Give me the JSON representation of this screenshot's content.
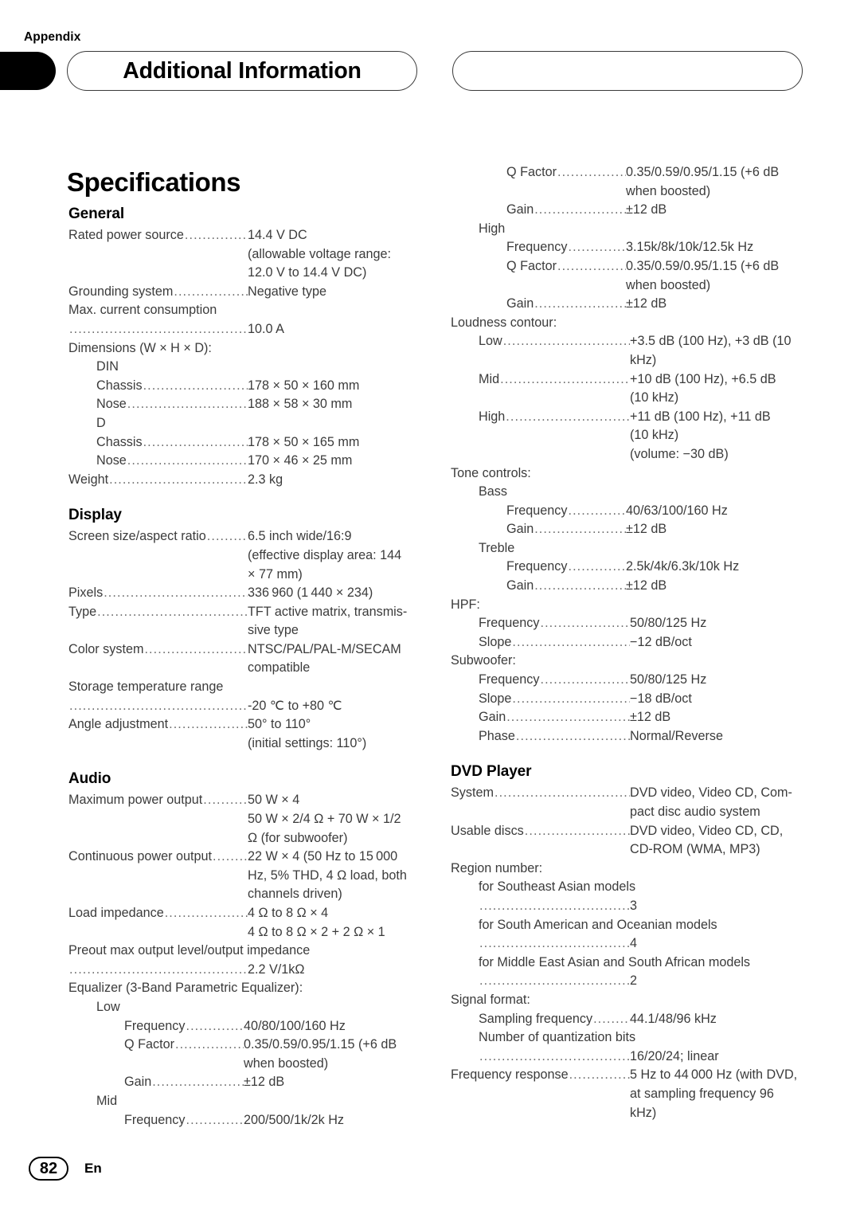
{
  "header": {
    "appendix_label": "Appendix",
    "title": "Additional Information"
  },
  "page_heading": "Specifications",
  "footer": {
    "page_number": "82",
    "language_code": "En"
  },
  "leader_dots": "....................................................................................................",
  "sections": {
    "general": {
      "title": "General",
      "rows": [
        {
          "label": "Rated power source",
          "value": "14.4 V DC"
        },
        {
          "label": "",
          "value": "(allowable voltage range:"
        },
        {
          "label": "",
          "value": "12.0 V to 14.4 V DC)"
        },
        {
          "label": "Grounding system",
          "value": "Negative type"
        },
        {
          "label": "Max. current consumption",
          "value": ""
        },
        {
          "label": "",
          "value": "10.0 A"
        },
        {
          "label": "Dimensions (W × H × D):",
          "value": ""
        },
        {
          "label": "DIN",
          "value": ""
        },
        {
          "label": "Chassis",
          "value": "178 × 50 × 160 mm"
        },
        {
          "label": "Nose",
          "value": "188 × 58 × 30 mm"
        },
        {
          "label": "D",
          "value": ""
        },
        {
          "label": "Chassis",
          "value": "178 × 50 × 165 mm"
        },
        {
          "label": "Nose",
          "value": "170 × 46 × 25 mm"
        },
        {
          "label": "Weight",
          "value": "2.3 kg"
        }
      ]
    },
    "display": {
      "title": "Display",
      "rows": [
        {
          "label": "Screen size/aspect ratio",
          "value": "6.5 inch wide/16:9"
        },
        {
          "label": "",
          "value": "(effective display area: 144"
        },
        {
          "label": "",
          "value": "× 77 mm)"
        },
        {
          "label": "Pixels",
          "value": "336 960 (1 440 × 234)"
        },
        {
          "label": "Type",
          "value": "TFT active matrix, transmis-"
        },
        {
          "label": "",
          "value": "sive type"
        },
        {
          "label": "Color system",
          "value": "NTSC/PAL/PAL-M/SECAM"
        },
        {
          "label": "",
          "value": "compatible"
        },
        {
          "label": "Storage temperature range",
          "value": ""
        },
        {
          "label": "",
          "value": "-20 ℃ to +80 ℃"
        },
        {
          "label": "Angle adjustment",
          "value": "50° to 110°"
        },
        {
          "label": "",
          "value": "(initial settings: 110°)"
        }
      ]
    },
    "audio": {
      "title": "Audio",
      "rows": [
        {
          "label": "Maximum power output",
          "value": "50 W × 4"
        },
        {
          "label": "",
          "value": "50 W × 2/4 Ω + 70 W × 1/2"
        },
        {
          "label": "",
          "value": "Ω (for subwoofer)"
        },
        {
          "label": "Continuous power output",
          "value": "22 W × 4 (50 Hz to 15 000"
        },
        {
          "label": "",
          "value": "Hz, 5% THD, 4 Ω load, both"
        },
        {
          "label": "",
          "value": "channels driven)"
        },
        {
          "label": "Load impedance",
          "value": "4 Ω to 8 Ω × 4"
        },
        {
          "label": "",
          "value": "4 Ω to 8 Ω × 2 + 2 Ω × 1"
        },
        {
          "label": "Preout max output level/output impedance",
          "value": ""
        },
        {
          "label": "",
          "value": "2.2 V/1kΩ"
        },
        {
          "label": "Equalizer (3-Band Parametric Equalizer):",
          "value": ""
        },
        {
          "label": "Low",
          "value": ""
        },
        {
          "label": "Frequency",
          "value": "40/80/100/160 Hz"
        },
        {
          "label": "Q Factor",
          "value": "0.35/0.59/0.95/1.15 (+6 dB"
        },
        {
          "label": "",
          "value": "when boosted)"
        },
        {
          "label": "Gain",
          "value": "±12 dB"
        },
        {
          "label": "Mid",
          "value": ""
        },
        {
          "label": "Frequency",
          "value": "200/500/1k/2k Hz"
        }
      ]
    },
    "audio_continued": {
      "rows": [
        {
          "label": "Q Factor",
          "value": "0.35/0.59/0.95/1.15 (+6 dB"
        },
        {
          "label": "",
          "value": "when boosted)"
        },
        {
          "label": "Gain",
          "value": "±12 dB"
        },
        {
          "label": "High",
          "value": ""
        },
        {
          "label": "Frequency",
          "value": "3.15k/8k/10k/12.5k Hz"
        },
        {
          "label": "Q Factor",
          "value": "0.35/0.59/0.95/1.15 (+6 dB"
        },
        {
          "label": "",
          "value": "when boosted)"
        },
        {
          "label": "Gain",
          "value": "±12 dB"
        },
        {
          "label": "Loudness contour:",
          "value": ""
        },
        {
          "label": "Low",
          "value": "+3.5 dB (100 Hz), +3 dB (10"
        },
        {
          "label": "",
          "value": "kHz)"
        },
        {
          "label": "Mid",
          "value": "+10 dB (100 Hz), +6.5 dB"
        },
        {
          "label": "",
          "value": "(10 kHz)"
        },
        {
          "label": "High",
          "value": "+11 dB (100 Hz), +11 dB"
        },
        {
          "label": "",
          "value": "(10 kHz)"
        },
        {
          "label": "",
          "value": "(volume: −30 dB)"
        },
        {
          "label": "Tone controls:",
          "value": ""
        },
        {
          "label": "Bass",
          "value": ""
        },
        {
          "label": "Frequency",
          "value": "40/63/100/160 Hz"
        },
        {
          "label": "Gain",
          "value": "±12 dB"
        },
        {
          "label": "Treble",
          "value": ""
        },
        {
          "label": "Frequency",
          "value": "2.5k/4k/6.3k/10k Hz"
        },
        {
          "label": "Gain",
          "value": "±12 dB"
        },
        {
          "label": "HPF:",
          "value": ""
        },
        {
          "label": "Frequency",
          "value": "50/80/125 Hz"
        },
        {
          "label": "Slope",
          "value": "−12 dB/oct"
        },
        {
          "label": "Subwoofer:",
          "value": ""
        },
        {
          "label": "Frequency",
          "value": "50/80/125 Hz"
        },
        {
          "label": "Slope",
          "value": "−18 dB/oct"
        },
        {
          "label": "Gain",
          "value": "±12 dB"
        },
        {
          "label": "Phase",
          "value": "Normal/Reverse"
        }
      ]
    },
    "dvd_player": {
      "title": "DVD Player",
      "rows": [
        {
          "label": "System",
          "value": "DVD video, Video CD, Com-"
        },
        {
          "label": "",
          "value": "pact disc audio system"
        },
        {
          "label": "Usable discs",
          "value": "DVD video, Video CD, CD,"
        },
        {
          "label": "",
          "value": "CD-ROM (WMA, MP3)"
        },
        {
          "label": "Region number:",
          "value": ""
        },
        {
          "label": "for Southeast Asian models",
          "value": ""
        },
        {
          "label": "",
          "value": "3"
        },
        {
          "label": "for South American and Oceanian models",
          "value": ""
        },
        {
          "label": "",
          "value": "4"
        },
        {
          "label": "for Middle East Asian and South African models",
          "value": ""
        },
        {
          "label": "",
          "value": "2"
        },
        {
          "label": "Signal format:",
          "value": ""
        },
        {
          "label": "Sampling frequency",
          "value": "44.1/48/96 kHz"
        },
        {
          "label": "Number of quantization bits",
          "value": ""
        },
        {
          "label": "",
          "value": "16/20/24; linear"
        },
        {
          "label": "Frequency response",
          "value": "5 Hz to 44 000 Hz (with DVD,"
        },
        {
          "label": "",
          "value": "at sampling frequency 96"
        },
        {
          "label": "",
          "value": "kHz)"
        }
      ]
    }
  }
}
